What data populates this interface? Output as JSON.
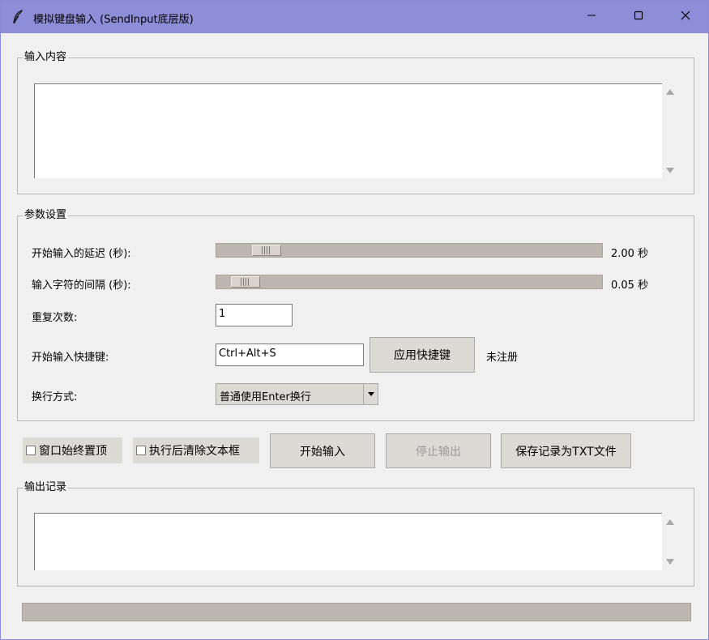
{
  "window": {
    "title": "模拟键盘输入 (SendInput底层版)",
    "icon": "feather-icon"
  },
  "input_group": {
    "label": "输入内容",
    "value": ""
  },
  "params_group": {
    "label": "参数设置",
    "start_delay": {
      "label": "开始输入的延迟 (秒):",
      "value_text": "2.00 秒",
      "slider_fraction": 0.1
    },
    "char_interval": {
      "label": "输入字符的间隔 (秒):",
      "value_text": "0.05 秒",
      "slider_fraction": 0.05
    },
    "repeat": {
      "label": "重复次数:",
      "value": "1"
    },
    "hotkey": {
      "label": "开始输入快捷键:",
      "value": "Ctrl+Alt+S",
      "apply_button": "应用快捷键",
      "status": "未注册"
    },
    "newline": {
      "label": "换行方式:",
      "selected": "普通使用Enter换行"
    }
  },
  "controls": {
    "always_on_top": {
      "label": "窗口始终置顶",
      "checked": false
    },
    "clear_after": {
      "label": "执行后清除文本框",
      "checked": false
    },
    "start_button": "开始输入",
    "stop_button": "停止输出",
    "save_button": "保存记录为TXT文件"
  },
  "output_group": {
    "label": "输出记录",
    "value": ""
  },
  "progress": {
    "fraction": 0
  },
  "colors": {
    "titlebar": "#8e8ed8",
    "window_bg": "#f0f0f0"
  }
}
